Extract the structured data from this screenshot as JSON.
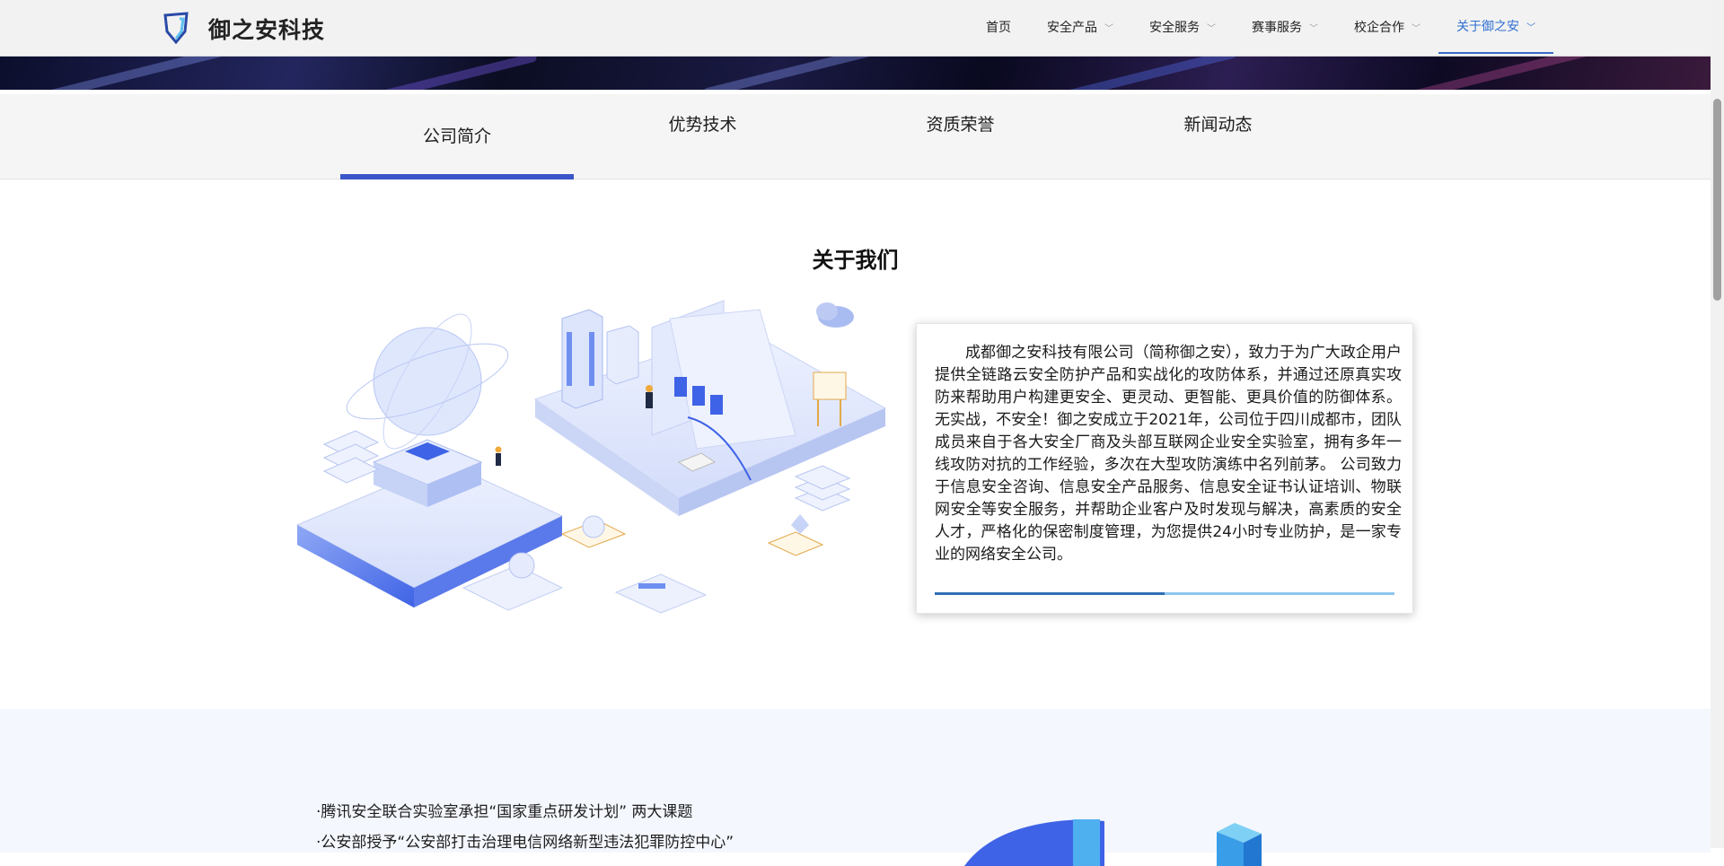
{
  "brand": {
    "name": "御之安科技",
    "icon": "shield-logo-icon"
  },
  "nav": {
    "items": [
      {
        "label": "首页",
        "has_dropdown": false
      },
      {
        "label": "安全产品",
        "has_dropdown": true
      },
      {
        "label": "安全服务",
        "has_dropdown": true
      },
      {
        "label": "赛事服务",
        "has_dropdown": true
      },
      {
        "label": "校企合作",
        "has_dropdown": true
      },
      {
        "label": "关于御之安",
        "has_dropdown": true,
        "active": true
      }
    ]
  },
  "subnav": {
    "tabs": [
      {
        "label": "公司简介",
        "active": true
      },
      {
        "label": "优势技术"
      },
      {
        "label": "资质荣誉"
      },
      {
        "label": "新闻动态"
      }
    ]
  },
  "about": {
    "title": "关于我们",
    "description": "成都御之安科技有限公司（简称御之安），致力于为广大政企用户提供全链路云安全防护产品和实战化的攻防体系，并通过还原真实攻防来帮助用户构建更安全、更灵动、更智能、更具价值的防御体系。无实战，不安全！御之安成立于2021年，公司位于四川成都市，团队成员来自于各大安全厂商及头部互联网企业安全实验室，拥有多年一线攻防对抗的工作经验，多次在大型攻防演练中名列前茅。 公司致力于信息安全咨询、信息安全产品服务、信息安全证书认证培训、物联网安全等安全服务，并帮助企业客户及时发现与解决，高素质的安全人才，严格化的保密制度管理，为您提供24小时专业防护，是一家专业的网络安全公司。",
    "scroll_progress": 0.5
  },
  "honors": {
    "items": [
      "·腾讯安全联合实验室承担“国家重点研发计划” 两大课题",
      "·公安部授予“公安部打击治理电信网络新型违法犯罪防控中心”"
    ]
  },
  "colors": {
    "accent": "#3b56c8",
    "nav_active": "#2f6fd1",
    "progress_fill": "#2f6fb5",
    "progress_track": "#8ec5ef"
  }
}
